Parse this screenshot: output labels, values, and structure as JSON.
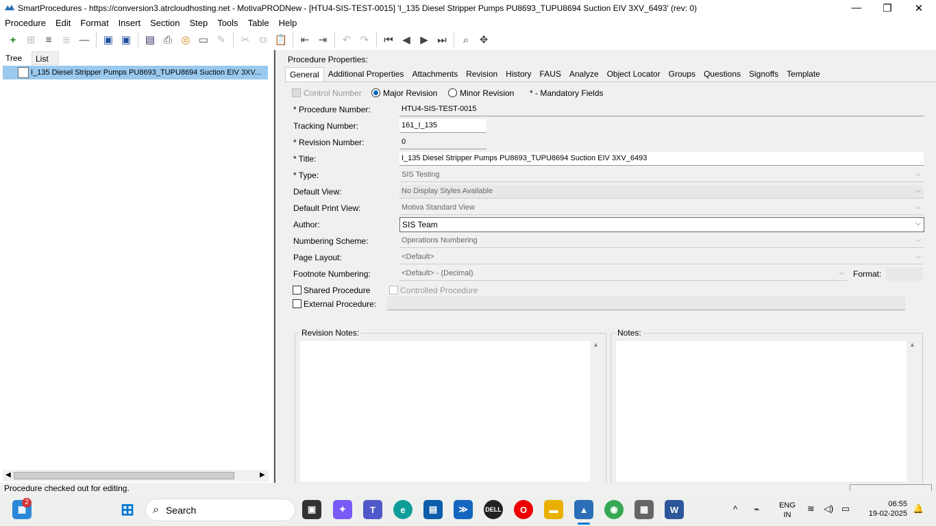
{
  "window": {
    "title": "SmartProcedures - https://conversion3.atrcloudhosting.net - MotivaPRODNew - [HTU4-SIS-TEST-0015] 'I_135 Diesel Stripper Pumps PU8693_TUPU8694 Suction EIV 3XV_6493' (rev: 0)",
    "minimize": "—",
    "maximize": "❐",
    "close": "✕"
  },
  "menu": [
    "Procedure",
    "Edit",
    "Format",
    "Insert",
    "Section",
    "Step",
    "Tools",
    "Table",
    "Help"
  ],
  "left": {
    "tabs": [
      "Tree",
      "List"
    ],
    "tree_item": "I_135  Diesel  Stripper  Pumps  PU8693_TUPU8694  Suction  EIV  3XV..."
  },
  "right": {
    "heading": "Procedure Properties:",
    "tabs": [
      "General",
      "Additional Properties",
      "Attachments",
      "Revision",
      "History",
      "FAUS",
      "Analyze",
      "Object Locator",
      "Groups",
      "Questions",
      "Signoffs",
      "Template"
    ]
  },
  "general": {
    "control_number": "Control Number",
    "major_revision": "Major Revision",
    "minor_revision": "Minor Revision",
    "mandatory_note": "* - Mandatory Fields",
    "procedure_number_label": "* Procedure Number:",
    "procedure_number": "HTU4-SIS-TEST-0015",
    "tracking_number_label": "Tracking Number:",
    "tracking_number": "161_I_135",
    "revision_number_label": "* Revision Number:",
    "revision_number": "0",
    "title_label": "* Title:",
    "title": "I_135 Diesel Stripper Pumps PU8693_TUPU8694 Suction EIV 3XV_6493",
    "type_label": "* Type:",
    "type": "SIS Testing",
    "default_view_label": "Default View:",
    "default_view": "No Display Styles Available",
    "default_print_view_label": "Default Print View:",
    "default_print_view": "Motiva Standard View",
    "author_label": "Author:",
    "author": "SIS Team",
    "numbering_scheme_label": "Numbering Scheme:",
    "numbering_scheme": "Operations Numbering",
    "page_layout_label": "Page Layout:",
    "page_layout": "<Default>",
    "footnote_numbering_label": "Footnote Numbering:",
    "footnote_numbering": "<Default> - (Decimal)",
    "format_label": "Format:",
    "shared_procedure": "Shared Procedure",
    "controlled_procedure": "Controlled Procedure",
    "external_procedure": "External Procedure:",
    "revision_notes": "Revision Notes:",
    "notes": "Notes:"
  },
  "status": "Procedure checked out for editing.",
  "taskbar": {
    "search": "Search",
    "badge": "2",
    "lang1": "ENG",
    "lang2": "IN",
    "time": "06:55",
    "date": "19-02-2025"
  }
}
